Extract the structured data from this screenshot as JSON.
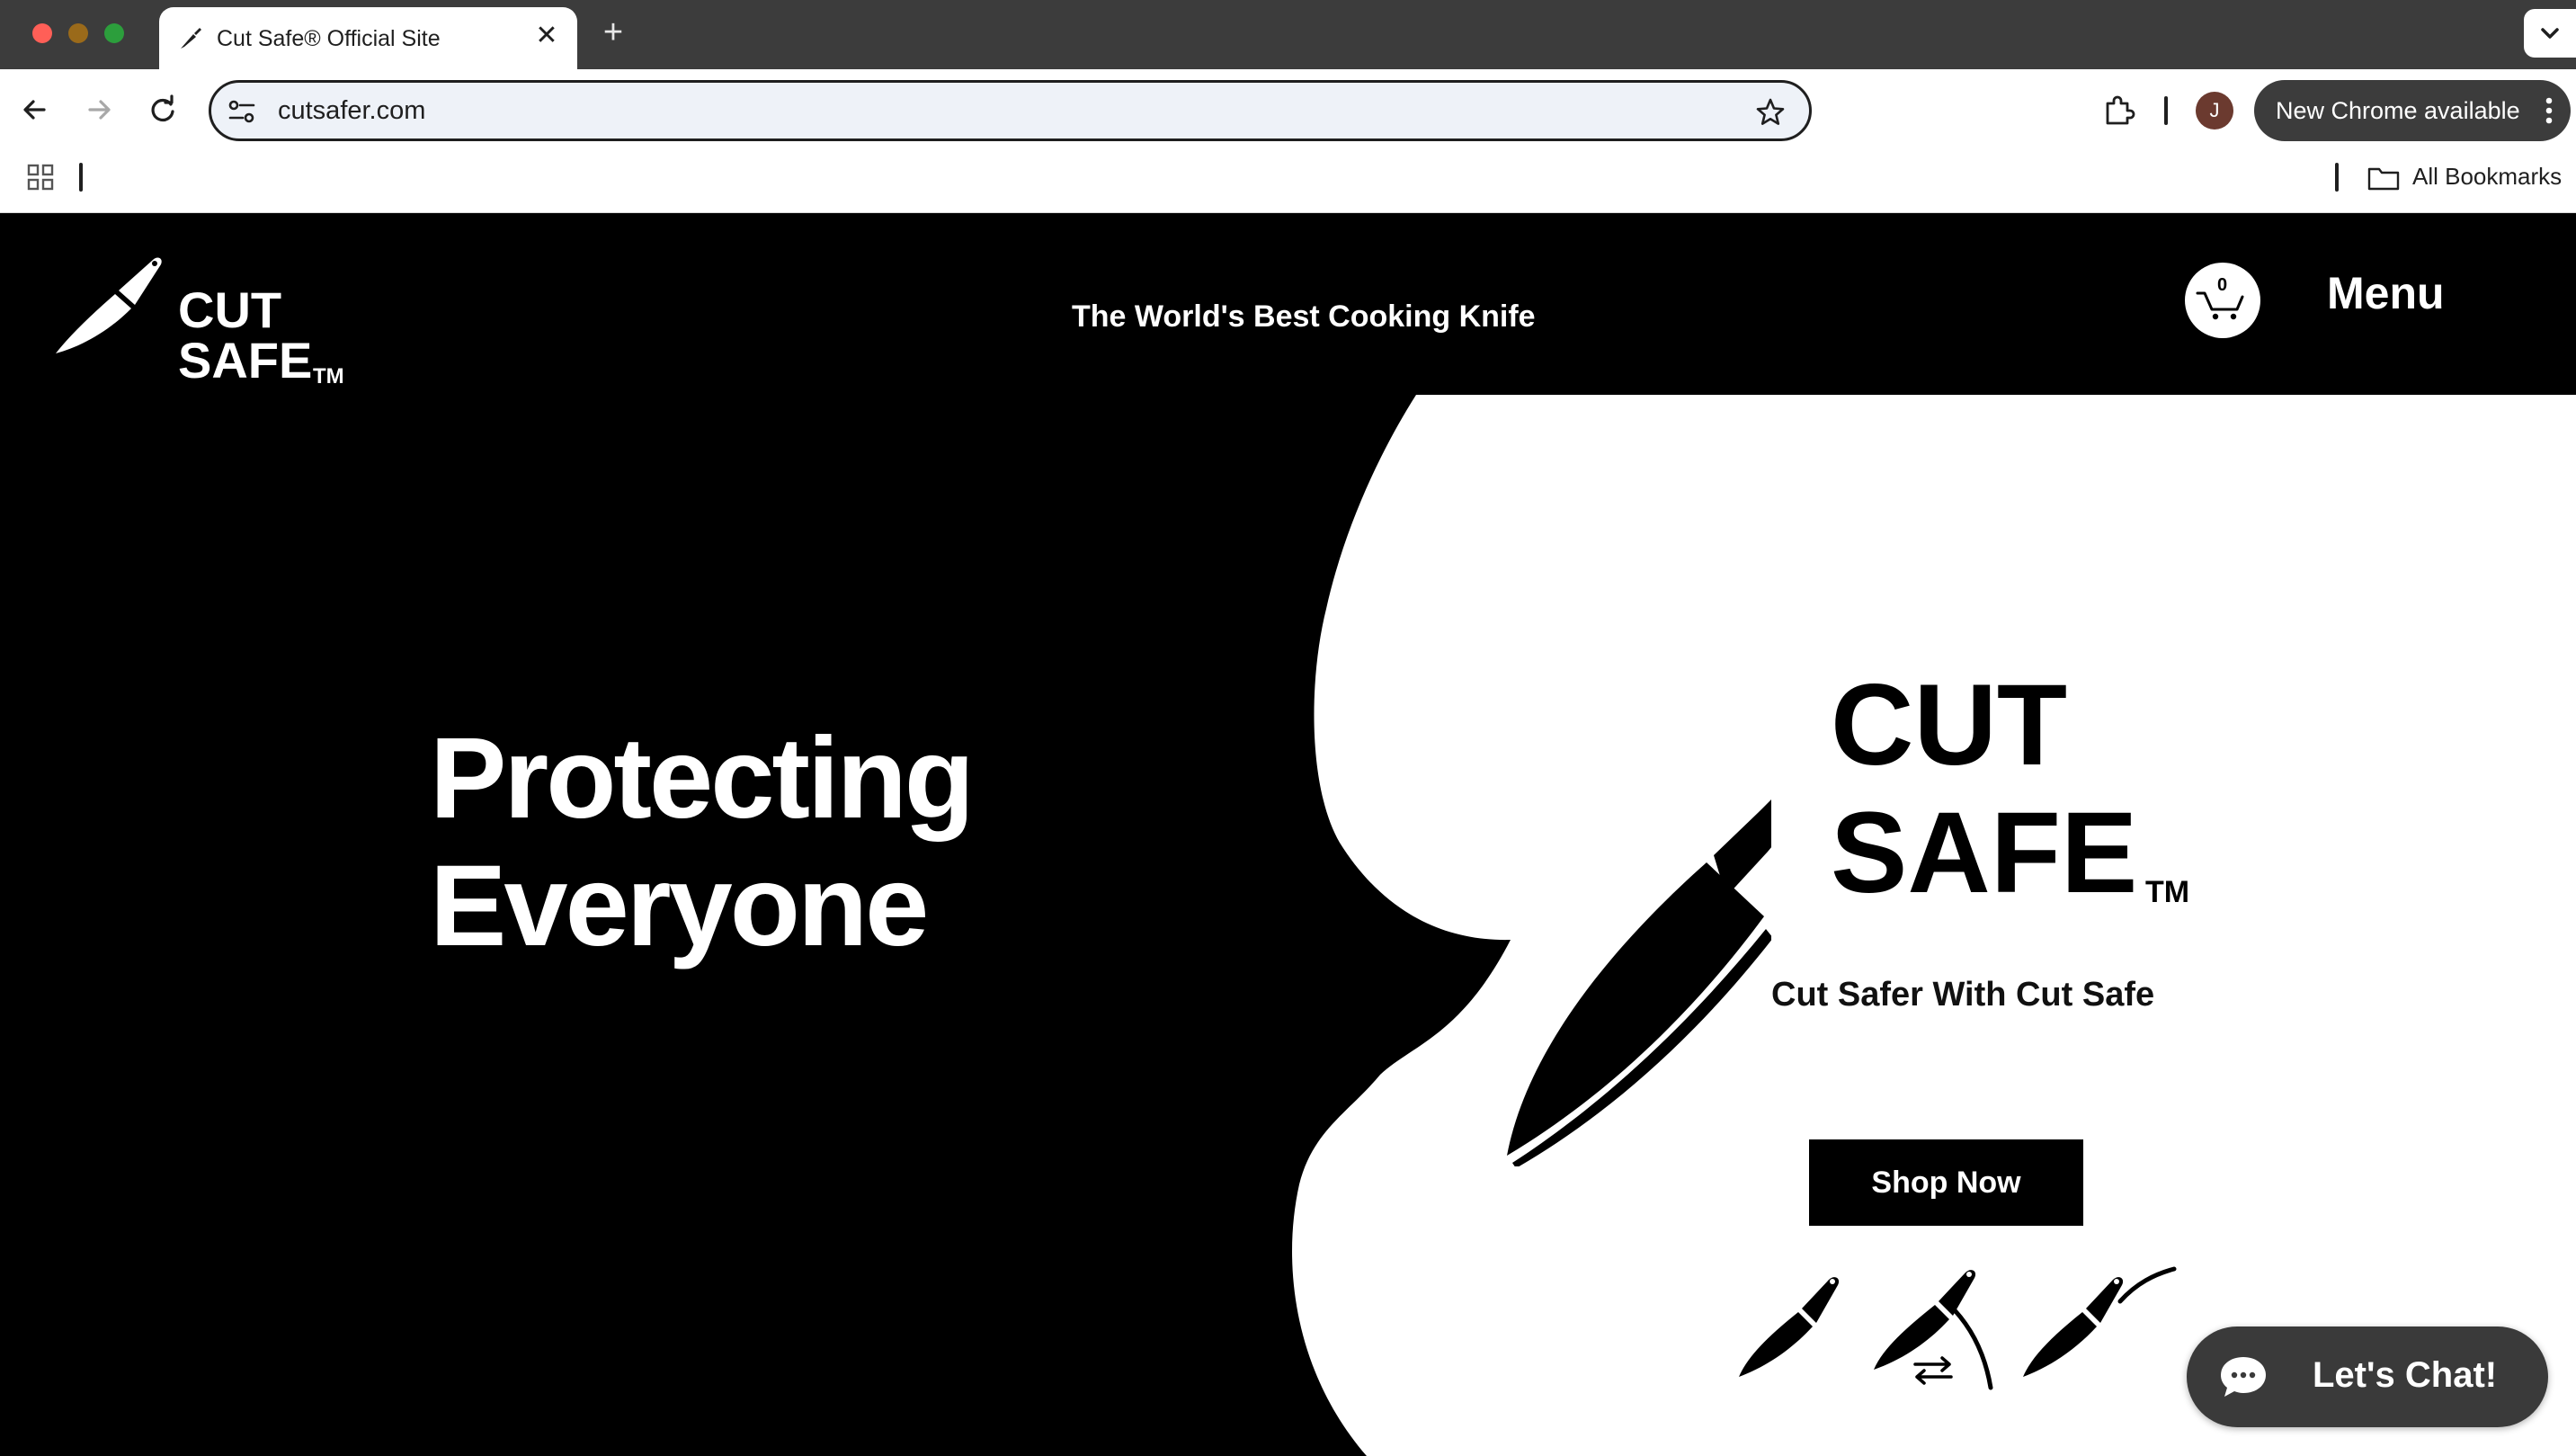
{
  "browser": {
    "tab": {
      "title": "Cut Safe® Official Site",
      "close_glyph": "✕",
      "favicon": "knife-icon"
    },
    "new_tab_glyph": "+",
    "address": {
      "url": "cutsafer.com"
    },
    "profile_initial": "J",
    "update_label": "New Chrome available",
    "bookmarks": {
      "all_label": "All Bookmarks"
    }
  },
  "site": {
    "logo": {
      "line1": "CUT",
      "line2": "SAFE",
      "tm": "TM"
    },
    "tagline": "The World's Best Cooking Knife",
    "cart_count": "0",
    "menu_label": "Menu"
  },
  "hero": {
    "heading_line1": "Protecting",
    "heading_line2": "Everyone",
    "logo_line1": "CUT",
    "logo_line2": "SAFE",
    "logo_tm": "TM",
    "subtitle": "Cut Safer With Cut Safe",
    "cta_label": "Shop Now",
    "feature_icons": [
      "knife-icon",
      "knife-sharpen-icon",
      "knife-curve-icon"
    ]
  },
  "chat": {
    "label": "Let's Chat!"
  },
  "colors": {
    "page_bg": "#000000",
    "hero_white": "#ffffff",
    "chrome_dark": "#3c3c3c",
    "omnibox_bg": "#eef2f8"
  }
}
